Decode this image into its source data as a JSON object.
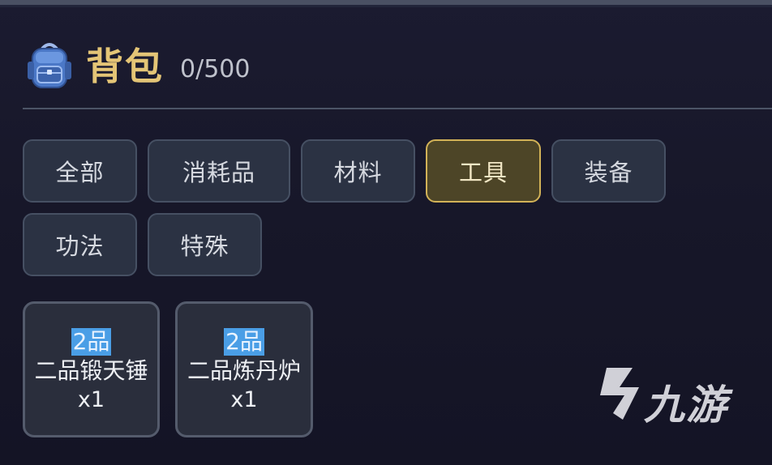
{
  "header": {
    "title": "背包",
    "capacity": "0/500"
  },
  "tabs": [
    {
      "label": "全部",
      "active": false
    },
    {
      "label": "消耗品",
      "active": false
    },
    {
      "label": "材料",
      "active": false
    },
    {
      "label": "工具",
      "active": true
    },
    {
      "label": "装备",
      "active": false
    },
    {
      "label": "功法",
      "active": false
    },
    {
      "label": "特殊",
      "active": false
    }
  ],
  "items": [
    {
      "grade": "2品",
      "name": "二品锻天锤",
      "quantity": "x1"
    },
    {
      "grade": "2品",
      "name": "二品炼丹炉",
      "quantity": "x1"
    }
  ],
  "watermark": {
    "text": "九游"
  },
  "colors": {
    "background": "#161628",
    "title_gold": "#e4c576",
    "active_tab_border": "#d2b257",
    "grade_badge": "#4a9ee6"
  },
  "icons": [
    "backpack-icon",
    "jiuyou-logo"
  ]
}
